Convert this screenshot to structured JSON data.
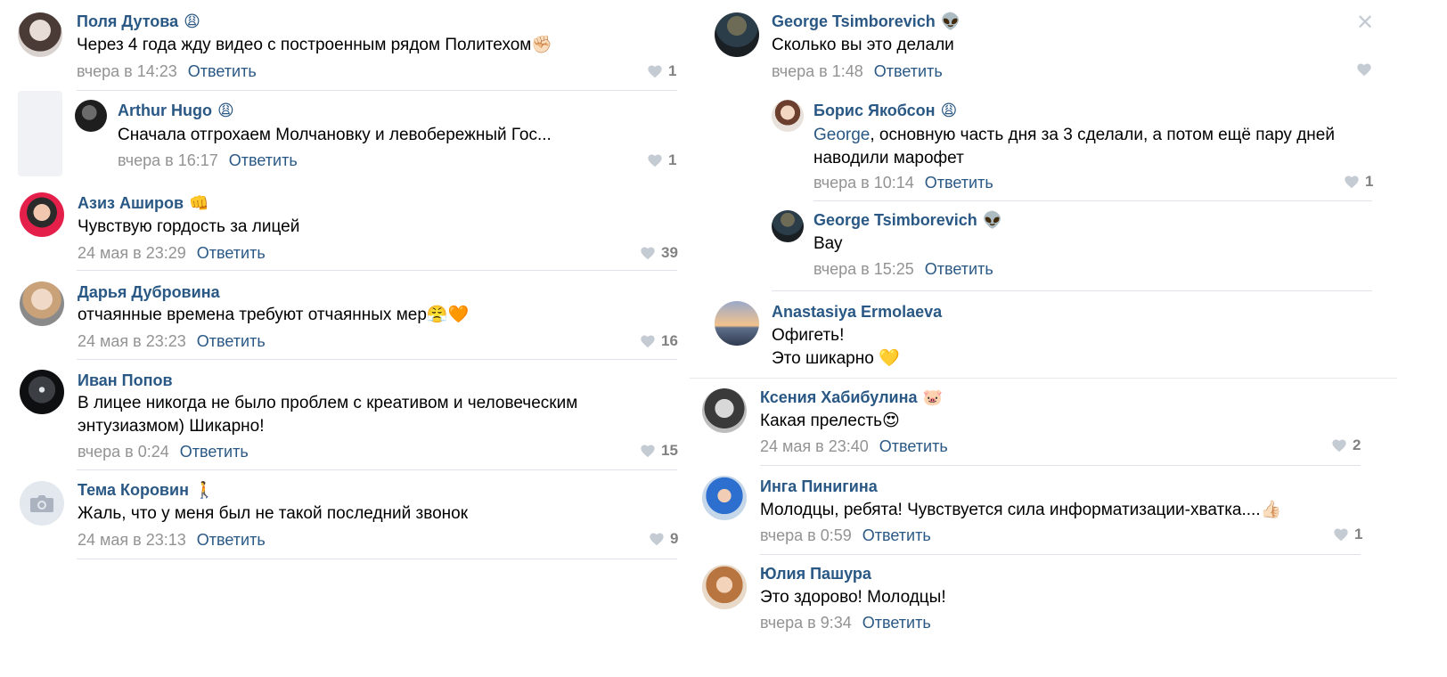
{
  "left": [
    {
      "author": "Поля Дутова",
      "emoji": "😩",
      "text": "Через 4 года жду видео с построенным рядом Политехом✊🏻",
      "time": "вчера в 14:23",
      "reply": "Ответить",
      "likes": "1"
    },
    {
      "author": "Arthur Hugo",
      "emoji": "😩",
      "text": "Сначала отгрохаем Молчановку и левобережный Гос...",
      "time": "вчера в 16:17",
      "reply": "Ответить",
      "likes": "1"
    },
    {
      "author": "Азиз Аширов",
      "emoji": "👊",
      "text": "Чувствую гордость за лицей",
      "time": "24 мая в 23:29",
      "reply": "Ответить",
      "likes": "39"
    },
    {
      "author": "Дарья Дубровина",
      "emoji": "",
      "text": "отчаянные времена требуют отчаянных мер😤🧡",
      "time": "24 мая в 23:23",
      "reply": "Ответить",
      "likes": "16"
    },
    {
      "author": "Иван Попов",
      "emoji": "",
      "text_line1": "В лицее никогда не было проблем с креативом и человеческим",
      "text_line2": "энтузиазмом) Шикарно!",
      "time": "вчера в 0:24",
      "reply": "Ответить",
      "likes": "15"
    },
    {
      "author": "Тема Коровин",
      "emoji": "🚶",
      "text": "Жаль, что у меня был не такой последний звонок",
      "time": "24 мая в 23:13",
      "reply": "Ответить",
      "likes": "9"
    }
  ],
  "right_top": [
    {
      "author": "George Tsimborevich",
      "emoji": "👽",
      "text": "Сколько вы это делали",
      "time": "вчера в 1:48",
      "reply": "Ответить",
      "likes": ""
    },
    {
      "author": "Борис Якобсон",
      "emoji": "😩",
      "mention": "George",
      "text_line1": ", основную часть дня за 3 сделали, а потом ещё пару дней",
      "text_line2": "наводили марофет",
      "time": "вчера в 10:14",
      "reply": "Ответить",
      "likes": "1"
    },
    {
      "author": "George Tsimborevich",
      "emoji": "👽",
      "text": "Вау",
      "time": "вчера в 15:25",
      "reply": "Ответить",
      "likes": ""
    },
    {
      "author": "Anastasiya Ermolaeva",
      "emoji": "",
      "text_line1": "Офигеть!",
      "text_line2": "Это шикарно 💛"
    }
  ],
  "right_bottom": [
    {
      "author": "Ксения Хабибулина",
      "emoji": "🐷",
      "text": "Какая прелесть😍",
      "time": "24 мая в 23:40",
      "reply": "Ответить",
      "likes": "2"
    },
    {
      "author": "Инга Пинигина",
      "emoji": "",
      "text": "Молодцы, ребята! Чувствуется сила информатизации-хватка....👍🏻",
      "time": "вчера в 0:59",
      "reply": "Ответить",
      "likes": "1"
    },
    {
      "author": "Юлия Пашура",
      "emoji": "",
      "text": "Это здорово! Молодцы!",
      "time": "вчера в 9:34",
      "reply": "Ответить",
      "likes": ""
    }
  ],
  "close_glyph": "✕",
  "colors": {
    "link": "#2a5885",
    "meta": "#939393",
    "separator": "#dfe2e8",
    "likes": "#828282"
  }
}
